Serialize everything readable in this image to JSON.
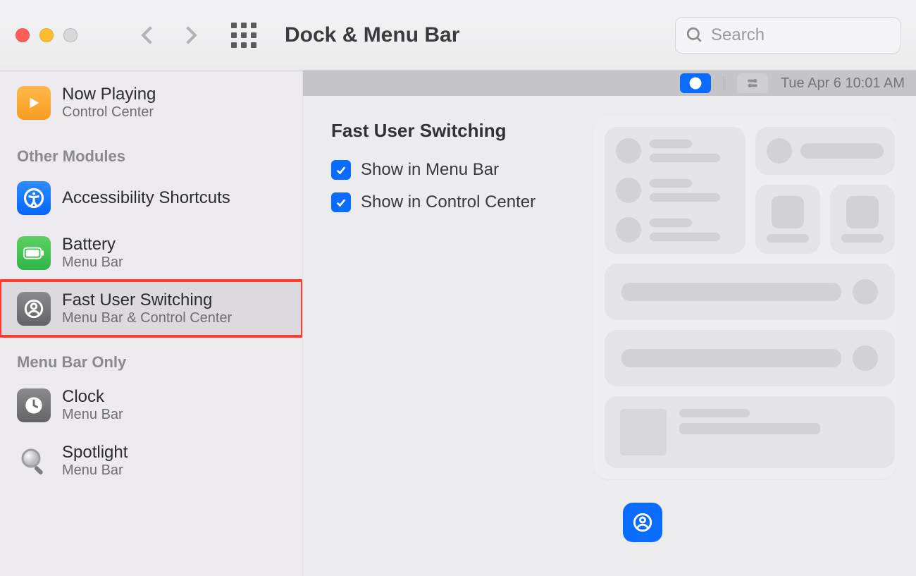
{
  "window": {
    "title": "Dock & Menu Bar"
  },
  "search": {
    "placeholder": "Search"
  },
  "sidebar": {
    "items": [
      {
        "name": "Now Playing",
        "sub": "Control Center"
      }
    ],
    "section_other": "Other Modules",
    "other_items": [
      {
        "name": "Accessibility Shortcuts",
        "sub": ""
      },
      {
        "name": "Battery",
        "sub": "Menu Bar"
      },
      {
        "name": "Fast User Switching",
        "sub": "Menu Bar & Control Center"
      }
    ],
    "section_menubar_only": "Menu Bar Only",
    "menubar_items": [
      {
        "name": "Clock",
        "sub": "Menu Bar"
      },
      {
        "name": "Spotlight",
        "sub": "Menu Bar"
      }
    ]
  },
  "content": {
    "title": "Fast User Switching",
    "checkbox1": "Show in Menu Bar",
    "checkbox2": "Show in Control Center"
  },
  "menubar_preview": {
    "datetime": "Tue Apr 6  10:01 AM"
  }
}
